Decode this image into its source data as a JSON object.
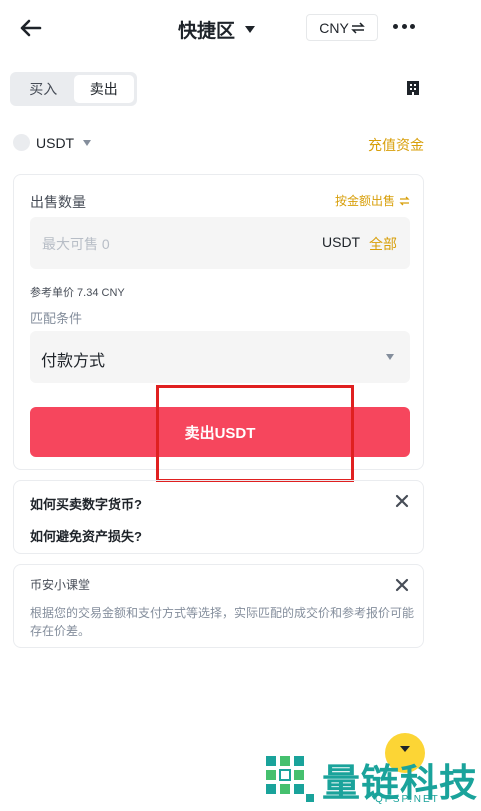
{
  "header": {
    "title": "快捷区",
    "currency": "CNY"
  },
  "tabs": {
    "buy": "买入",
    "sell": "卖出",
    "active": "sell"
  },
  "asset": {
    "coin": "USDT",
    "deposit_link": "充值资金"
  },
  "sell_form": {
    "quantity_label": "出售数量",
    "by_amount_link": "按金额出售",
    "amount_placeholder": "最大可售 0",
    "amount_unit": "USDT",
    "all_button": "全部",
    "reference_price": "参考单价 7.34 CNY",
    "match_label": "匹配条件",
    "payment_label": "付款方式",
    "sell_button": "卖出USDT"
  },
  "faq": {
    "q1": "如何买卖数字货币?",
    "q2": "如何避免资产损失?"
  },
  "tip": {
    "title": "币安小课堂",
    "text": "根据您的交易金额和支付方式等选择，实际匹配的成交价和参考报价可能存在价差。"
  },
  "watermark": {
    "name": "量链科技",
    "domain": "QFSP.NET"
  },
  "colors": {
    "accent": "#d89f0a",
    "sell_red": "#f6465d",
    "highlight_red": "#e02020",
    "brand_yellow": "#fcd535",
    "watermark_teal": "#1aa39b"
  },
  "icons": [
    "back-arrow-icon",
    "caret-down-icon",
    "swap-icon",
    "more-icon",
    "orders-icon",
    "close-icon",
    "chevron-down-icon"
  ]
}
